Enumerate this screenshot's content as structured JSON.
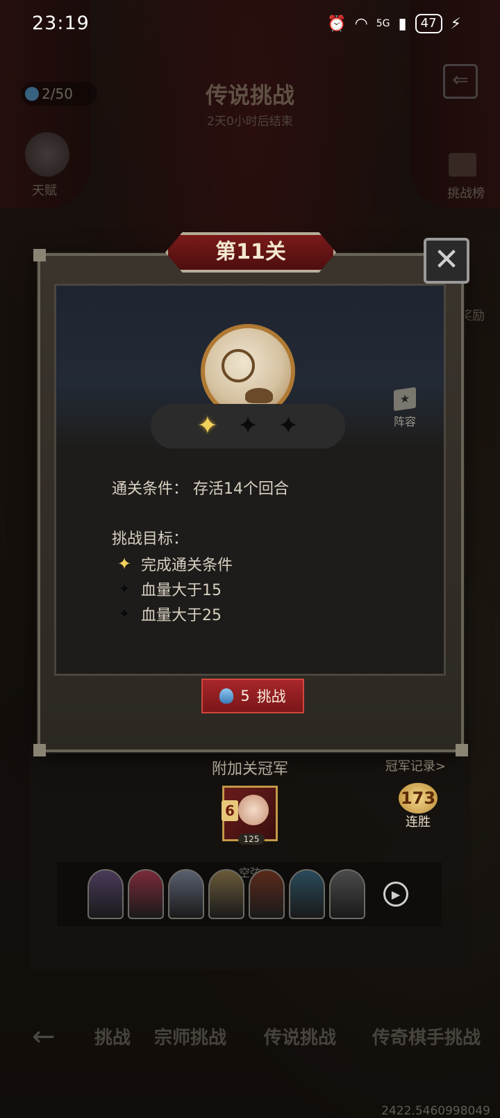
{
  "status_bar": {
    "time": "23:19",
    "network": "5G",
    "battery": "47"
  },
  "header": {
    "title": "传说挑战",
    "subtitle": "2天0小时后结束",
    "gem_count": "2/50"
  },
  "left_side": {
    "talent_label": "天赋"
  },
  "right_side": {
    "ranking_label": "挑战榜",
    "reward_label": "奖励"
  },
  "modal": {
    "level_title": "第11关",
    "close_symbol": "✕",
    "lineup_label": "阵容",
    "stars": [
      "lit",
      "off",
      "off"
    ],
    "condition_label": "通关条件：",
    "condition_value": "存活14个回合",
    "goals_title": "挑战目标：",
    "goals": [
      {
        "text": "完成通关条件",
        "state": "lit"
      },
      {
        "text": "血量大于15",
        "state": "off"
      },
      {
        "text": "血量大于25",
        "state": "off"
      }
    ],
    "challenge_cost": "5",
    "challenge_label": "挑战"
  },
  "panel": {
    "title": "附加关冠军",
    "record_link": "冠军记录>",
    "champion": {
      "name": "空弦",
      "level": "6",
      "rating": "125"
    },
    "streak_value": "173",
    "streak_label": "连胜",
    "lineup_colors": [
      "#4a3a5a",
      "#7a2a3a",
      "#5a6070",
      "#6a5a3a",
      "#5a2a1a",
      "#2a4a5a",
      "#4a4a4a"
    ]
  },
  "bottom_tabs": [
    "挑战",
    "宗师挑战",
    "传说挑战",
    "传奇棋手挑战"
  ],
  "footer_number": "2422.5460998049"
}
